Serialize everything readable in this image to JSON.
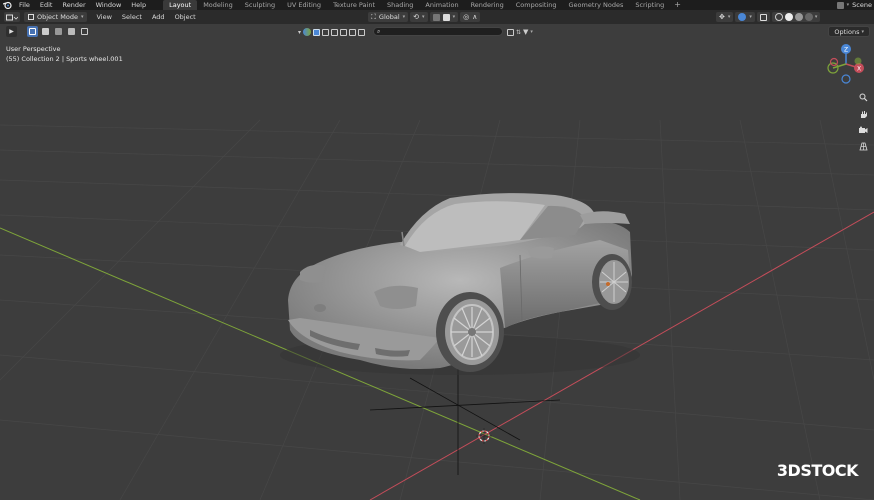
{
  "menubar": {
    "items": [
      "File",
      "Edit",
      "Render",
      "Window",
      "Help"
    ],
    "workspaces": [
      "Layout",
      "Modeling",
      "Sculpting",
      "UV Editing",
      "Texture Paint",
      "Shading",
      "Animation",
      "Rendering",
      "Compositing",
      "Geometry Nodes",
      "Scripting"
    ],
    "active_workspace": "Layout",
    "add_tab": "+",
    "scene": "Scene"
  },
  "header": {
    "mode": "Object Mode",
    "menus": [
      "View",
      "Select",
      "Add",
      "Object"
    ],
    "transform_orientation": "Global"
  },
  "toolbar": {
    "search_placeholder": "",
    "options_label": "Options"
  },
  "viewport": {
    "view_name": "User Perspective",
    "collection_info": "(55) Collection 2 | Sports wheel.001"
  },
  "gizmo": {
    "z": "Z",
    "y": "Y",
    "x": "X"
  },
  "watermark": "3DSTOCK",
  "colors": {
    "viewport_bg": "#3d3d3d",
    "x_axis": "#c44d5a",
    "y_axis": "#7ea43a",
    "z_axis": "#4a87d6",
    "active_tab": "#3a3a3a"
  },
  "icons": [
    "blender-logo-icon",
    "editor-type-icon",
    "mode-icon",
    "transform-orientation-icon",
    "pivot-icon",
    "snap-icon",
    "proportional-edit-icon",
    "visibility-icon",
    "overlay-icon",
    "xray-icon",
    "shading-icon",
    "zoom-icon",
    "pan-icon",
    "camera-icon",
    "grid-icon",
    "cursor-icon"
  ]
}
